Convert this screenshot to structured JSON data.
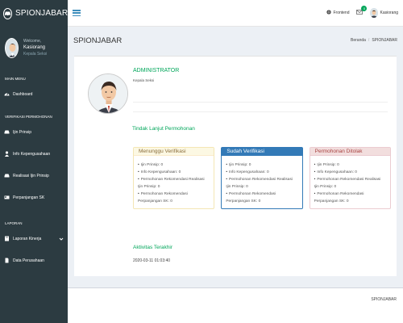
{
  "app": {
    "brand": "SPIONJABAR"
  },
  "sidebar": {
    "user": {
      "welcome": "Welcome,",
      "name": "Kasiorang",
      "role": "Kepala Seksi"
    },
    "sections": [
      {
        "header": "MAIN MENU",
        "items": [
          {
            "label": "Dashboard",
            "icon": "dashboard-icon"
          }
        ]
      },
      {
        "header": "VERIFIKASI PERMOHONAN",
        "items": [
          {
            "label": "Ijin Prinsip",
            "icon": "car-icon"
          },
          {
            "label": "Info Kepengusahaan",
            "icon": "user-icon"
          },
          {
            "label": "Realisasi Ijin Prinsip",
            "icon": "car-icon"
          },
          {
            "label": "Perpanjangan SK",
            "icon": "id-card-icon"
          }
        ]
      },
      {
        "header": "LAPORAN",
        "items": [
          {
            "label": "Laporan Kinerja",
            "icon": "book-icon"
          },
          {
            "label": "Data Perusahaan",
            "icon": "file-icon"
          }
        ]
      }
    ]
  },
  "topbar": {
    "frontend_label": "Frontend",
    "notif_count": "0",
    "user_name": "Kasiorang"
  },
  "content": {
    "page_title": "SPIONJABAR",
    "breadcrumb": [
      "Beranda",
      "SPIONJABAR"
    ],
    "profile": {
      "title": "ADMINISTRATOR",
      "subtitle": "Kepala Seksi"
    },
    "followup_title": "Tindak Lanjut Permohonan",
    "cards": [
      {
        "title": "Menunggu Verifikasi",
        "variant": "warning",
        "color": "#fcf8e3",
        "lines": [
          "Ijin Prinsip: 0",
          "Info Kepengusahaan: 0",
          "Permohonan Rekomendasi Realisasi",
          "Ijin Prinsip: 0",
          "Permohonan Rekomendasi",
          "Perpanjangan SK: 0"
        ]
      },
      {
        "title": "Sudah Verifikasi",
        "variant": "primary",
        "color": "#337ab7",
        "lines": [
          "Ijin Prinsip: 0",
          "Info Kepengusahaan: 0",
          "Permohonan Rekomendasi Realisasi",
          "Ijin Prinsip: 0",
          "Permohonan Rekomendasi",
          "Perpanjangan SK: 0"
        ]
      },
      {
        "title": "Permohonan Ditolak",
        "variant": "danger",
        "color": "#f2dede",
        "lines": [
          "Ijin Prinsip: 0",
          "Info Kepengusahaan: 0",
          "Permohonan Rekomendasi Realisasi",
          "Ijin Prinsip: 0",
          "Permohonan Rekomendasi",
          "Perpanjangan SK: 0"
        ]
      }
    ],
    "activity_title": "Aktivitas Terakhir",
    "activity_time": "2020-03-11 01:03:40"
  },
  "footer": {
    "text": "SPIONJABAR"
  }
}
